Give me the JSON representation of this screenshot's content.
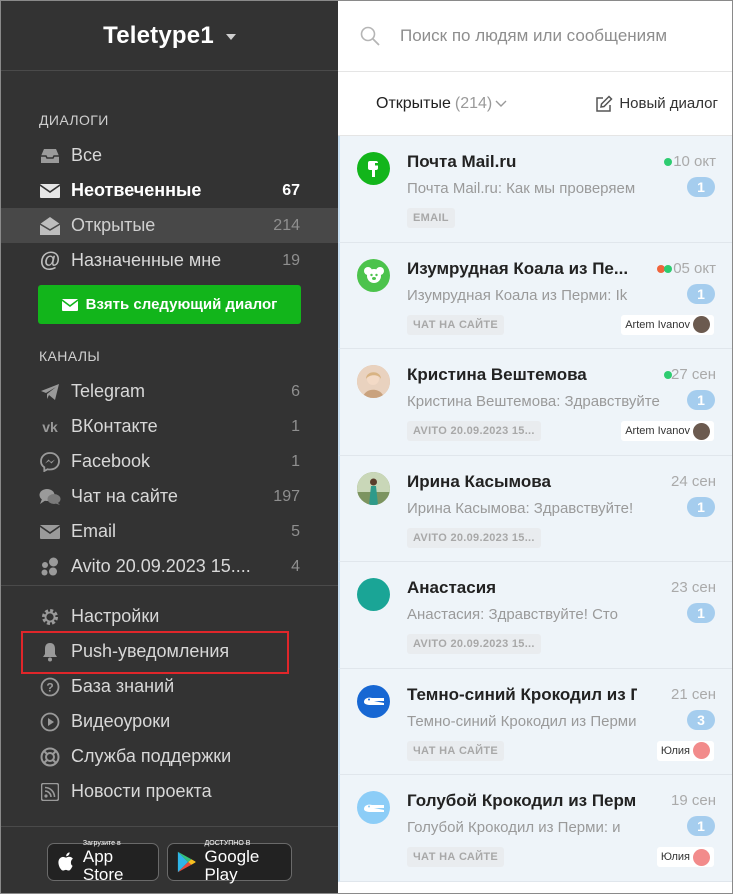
{
  "workspace": {
    "title": "Teletype1"
  },
  "sidebar": {
    "dialogs_title": "ДИАЛОГИ",
    "dialogs": [
      {
        "label": "Все",
        "count": "",
        "icon": "inbox-icon"
      },
      {
        "label": "Неотвеченные",
        "count": "67",
        "icon": "envelope-icon"
      },
      {
        "label": "Открытые",
        "count": "214",
        "icon": "open-envelope-icon"
      },
      {
        "label": "Назначенные мне",
        "count": "19",
        "icon": "at-icon"
      }
    ],
    "take_button": "Взять следующий диалог",
    "channels_title": "КАНАЛЫ",
    "channels": [
      {
        "label": "Telegram",
        "count": "6",
        "icon": "telegram-icon"
      },
      {
        "label": "ВКонтакте",
        "count": "1",
        "icon": "vk-icon"
      },
      {
        "label": "Facebook",
        "count": "1",
        "icon": "messenger-icon"
      },
      {
        "label": "Чат на сайте",
        "count": "197",
        "icon": "chat-icon"
      },
      {
        "label": "Email",
        "count": "5",
        "icon": "envelope-icon"
      },
      {
        "label": "Avito 20.09.2023 15....",
        "count": "4",
        "icon": "avito-icon"
      }
    ],
    "menu": [
      {
        "label": "Настройки",
        "icon": "gear-icon"
      },
      {
        "label": "Push-уведомления",
        "icon": "bell-icon"
      },
      {
        "label": "База знаний",
        "icon": "question-icon"
      },
      {
        "label": "Видеоуроки",
        "icon": "play-icon"
      },
      {
        "label": "Служба поддержки",
        "icon": "lifebuoy-icon"
      },
      {
        "label": "Новости проекта",
        "icon": "rss-icon"
      }
    ],
    "app_store": {
      "small": "Загрузите в",
      "big": "App Store"
    },
    "google_play": {
      "small": "ДОСТУПНО В",
      "big": "Google Play"
    }
  },
  "search": {
    "placeholder": "Поиск по людям или сообщениям"
  },
  "filter": {
    "label": "Открытые",
    "count": "(214)",
    "new_dialog": "Новый диалог"
  },
  "colors": {
    "green": "#12b51b",
    "sidebar": "#333333",
    "online": "#2ecc71",
    "badge": "#a5cdee"
  },
  "conversations": [
    {
      "name": "Почта Mail.ru",
      "date": "10 окт",
      "preview": "Почта Mail.ru: Как мы проверяем",
      "unread": "1",
      "tag": "EMAIL",
      "assignee": "",
      "dots": [
        "#2ecc71"
      ],
      "avatar_color": "#12b51b"
    },
    {
      "name": "Изумрудная Коала из Пе...",
      "date": "05 окт",
      "preview": "Изумрудная Коала из Перми: Ik",
      "unread": "1",
      "tag": "ЧАТ НА САЙТЕ",
      "assignee": "Artem Ivanov",
      "dots": [
        "#f0643c",
        "#2ecc71"
      ],
      "avatar_color": "#4cc34c"
    },
    {
      "name": "Кристина Вештемова",
      "date": "27 сен",
      "preview": "Кристина Вештемова: Здравствуйте",
      "unread": "1",
      "tag": "AVITO 20.09.2023 15...",
      "assignee": "Artem Ivanov",
      "dots": [
        "#2ecc71"
      ],
      "avatar_color": "#d9b79a"
    },
    {
      "name": "Ирина Касымова",
      "date": "24 сен",
      "preview": "Ирина Касымова: Здравствуйте!",
      "unread": "1",
      "tag": "AVITO 20.09.2023 15...",
      "assignee": "",
      "dots": [],
      "avatar_color": "#8aa06a"
    },
    {
      "name": "Анастасия",
      "date": "23 сен",
      "preview": "Анастасия: Здравствуйте!  Сто",
      "unread": "1",
      "tag": "AVITO 20.09.2023 15...",
      "assignee": "",
      "dots": [],
      "avatar_color": "#1aa596"
    },
    {
      "name": "Темно-синий Крокодил из П...",
      "date": "21 сен",
      "preview": "Темно-синий Крокодил из Перми",
      "unread": "3",
      "tag": "ЧАТ НА САЙТЕ",
      "assignee": "Юлия",
      "dots": [],
      "avatar_color": "#1767d3"
    },
    {
      "name": "Голубой Крокодил из Перми",
      "date": "19 сен",
      "preview": "Голубой Крокодил из Перми: и",
      "unread": "1",
      "tag": "ЧАТ НА САЙТЕ",
      "assignee": "Юлия",
      "dots": [],
      "avatar_color": "#8ccdf7"
    }
  ]
}
